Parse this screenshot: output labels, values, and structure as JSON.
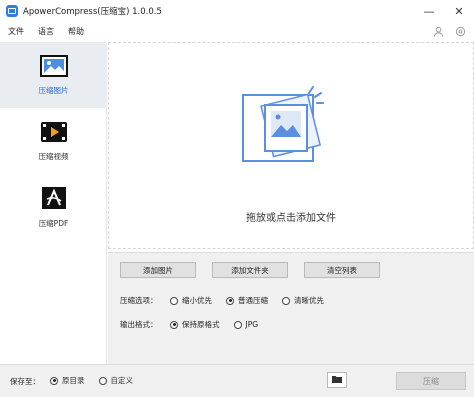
{
  "window": {
    "title": "ApowerCompress(压缩宝) 1.0.0.5",
    "minimize": "—",
    "close": "✕"
  },
  "menu": {
    "items": [
      "文件",
      "语言",
      "帮助"
    ]
  },
  "sidebar": {
    "items": [
      {
        "label": "压缩图片",
        "icon": "image-icon",
        "active": true
      },
      {
        "label": "压缩视频",
        "icon": "film-icon",
        "active": false
      },
      {
        "label": "压缩PDF",
        "icon": "pdf-icon",
        "active": false
      }
    ]
  },
  "dropzone": {
    "text": "拖放或点击添加文件"
  },
  "actions": {
    "add_image": "添加图片",
    "add_folder": "添加文件夹",
    "clear_list": "清空列表"
  },
  "options": {
    "compress_label": "压缩选项：",
    "compress_opts": [
      {
        "label": "缩小优先",
        "selected": false
      },
      {
        "label": "普通压缩",
        "selected": true
      },
      {
        "label": "清晰优先",
        "selected": false
      }
    ],
    "format_label": "输出格式：",
    "format_opts": [
      {
        "label": "保持原格式",
        "selected": true
      },
      {
        "label": "JPG",
        "selected": false
      }
    ]
  },
  "footer": {
    "save_label": "保存至：",
    "save_opts": [
      {
        "label": "原目录",
        "selected": true
      },
      {
        "label": "自定义",
        "selected": false
      }
    ],
    "compress_button": "压缩"
  },
  "colors": {
    "accent": "#2a6fd6",
    "illustration": "#5b8fe0"
  }
}
